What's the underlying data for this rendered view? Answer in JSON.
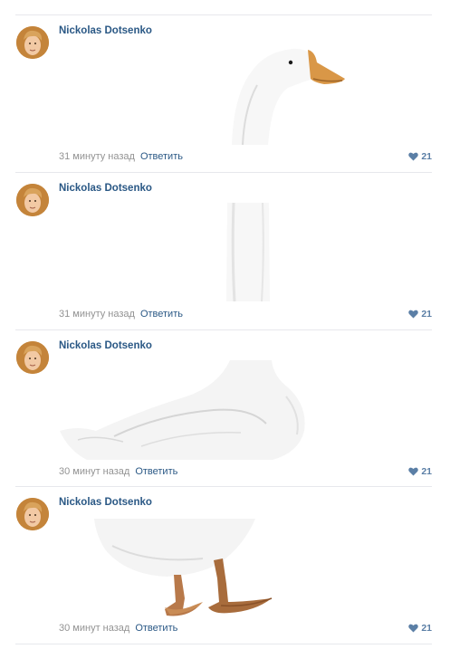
{
  "comments": [
    {
      "author": "Nickolas Dotsenko",
      "time": "31 минуту назад",
      "reply_label": "Ответить",
      "likes": "21",
      "photo_part": "head"
    },
    {
      "author": "Nickolas Dotsenko",
      "time": "31 минуту назад",
      "reply_label": "Ответить",
      "likes": "21",
      "photo_part": "neck"
    },
    {
      "author": "Nickolas Dotsenko",
      "time": "30 минут назад",
      "reply_label": "Ответить",
      "likes": "21",
      "photo_part": "body"
    },
    {
      "author": "Nickolas Dotsenko",
      "time": "30 минут назад",
      "reply_label": "Ответить",
      "likes": "21",
      "photo_part": "legs"
    }
  ],
  "icons": {
    "like": "heart-icon",
    "avatar": "user-avatar"
  },
  "colors": {
    "link": "#2a5885",
    "meta": "#939393",
    "like": "#5b7fa6",
    "divider": "#e7e8ec"
  }
}
